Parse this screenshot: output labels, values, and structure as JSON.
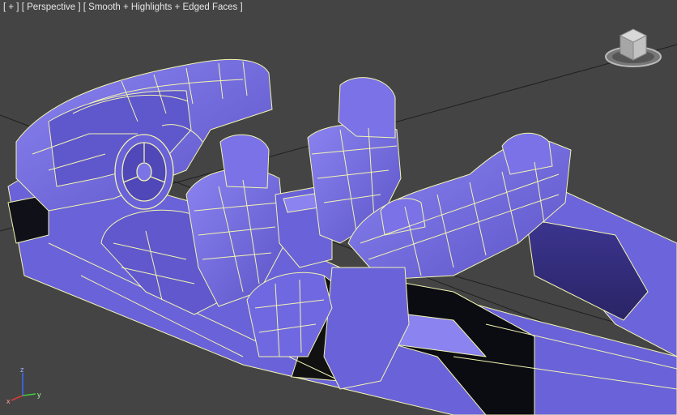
{
  "viewport": {
    "label_parts": [
      "[ + ]",
      "[ Perspective ]",
      "[ Smooth + Highlights + Edged Faces ]"
    ],
    "background": "#444444",
    "model_color": "#7068e0",
    "model_shadow": "#4a43a8",
    "edge_color": "#f2f5b0",
    "grid_color": "#1c1c1c"
  },
  "viewcube": {
    "icon": "viewcube-icon"
  },
  "axis": {
    "x": "x",
    "y": "y",
    "z": "z"
  }
}
